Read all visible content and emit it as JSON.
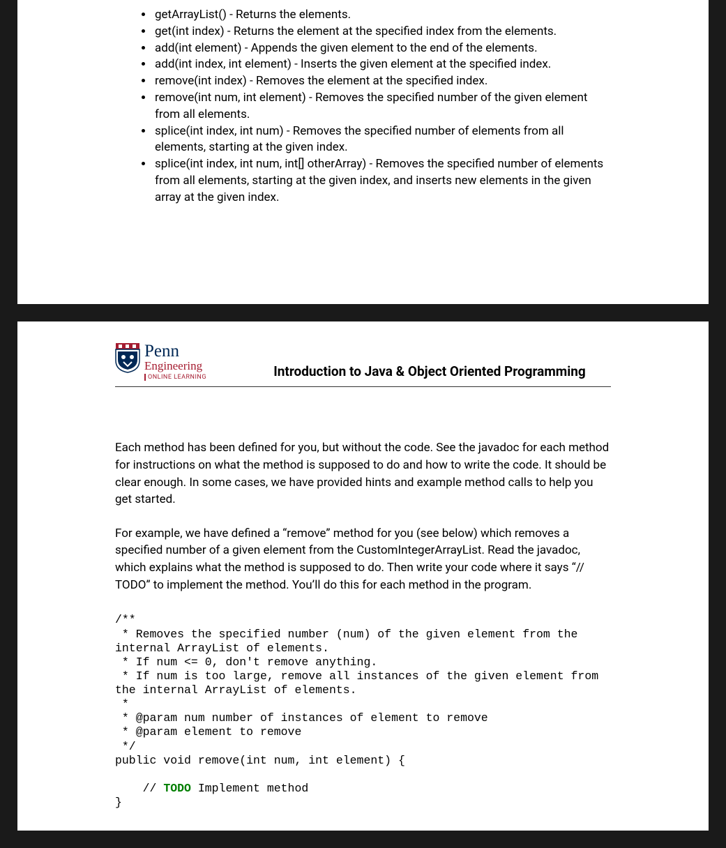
{
  "methods": [
    "getArrayList() - Returns the elements.",
    "get(int index) - Returns the element at the specified index from the elements.",
    "add(int element) - Appends the given element to the end of the elements.",
    "add(int index, int element) - Inserts the given element at the specified index.",
    "remove(int index) - Removes the element at the specified index.",
    "remove(int num, int element) - Removes the specified number of the given element from all elements.",
    "splice(int index, int num) - Removes the specified number of elements from all elements, starting at the given index.",
    "splice(int index, int num, int[] otherArray) - Removes the specified number of elements from all elements, starting at the given index, and inserts new elements in the given array at the given index."
  ],
  "logo": {
    "penn": "Penn",
    "engineering": "Engineering",
    "online": "ONLINE LEARNING"
  },
  "course_title": "Introduction to Java & Object Oriented Programming",
  "para1": "Each method has been defined for you, but without the code. See the javadoc for each method for instructions on what the method is supposed to do and how to write the code. It should be clear enough.  In some cases, we have provided hints and example method calls to help you get started.",
  "para2": "For example, we have defined a “remove” method for you (see below) which removes a specified number of a given element from the CustomIntegerArrayList.  Read the javadoc, which explains what the method is supposed to do.  Then write your code where it says “// TODO” to implement the method.  You’ll do this for each method in the program.",
  "code": {
    "l1": "/**",
    "l2": " * Removes the specified number (num) of the given element from the internal ArrayList of elements.",
    "l3": " * If num <= 0, don't remove anything.",
    "l4": " * If num is too large, remove all instances of the given element from the internal ArrayList of elements.",
    "l5": " *",
    "l6": " * @param num number of instances of element to remove",
    "l7": " * @param element to remove",
    "l8": " */",
    "l9": "public void remove(int num, int element) {",
    "l10": "",
    "l11a": "    // ",
    "l11b": "TODO",
    "l11c": " Implement method",
    "l12": "}"
  }
}
